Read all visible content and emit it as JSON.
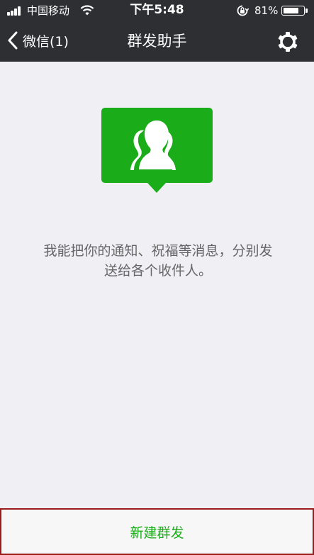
{
  "status_bar": {
    "carrier": "中国移动",
    "time": "下午5:48",
    "battery_percent": "81%",
    "battery_level": 0.81
  },
  "nav": {
    "back_label": "微信(1)",
    "title": "群发助手"
  },
  "main": {
    "description": "我能把你的通知、祝福等消息，分别发送给各个收件人。"
  },
  "bottom_button": {
    "label": "新建群发"
  },
  "colors": {
    "accent_green": "#1aad19",
    "nav_background": "#2e2f33",
    "page_background": "#efeff4"
  },
  "icons": [
    "signal-icon",
    "wifi-icon",
    "orientation-lock-icon",
    "battery-icon",
    "back-chevron-icon",
    "gear-icon",
    "group-broadcast-icon"
  ]
}
